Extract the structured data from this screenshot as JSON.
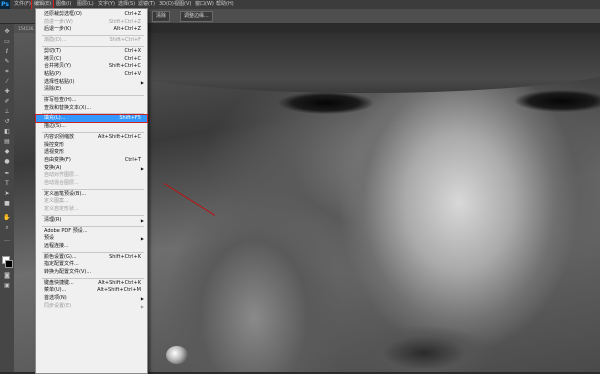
{
  "app": {
    "logo": "Ps"
  },
  "menubar": {
    "items": [
      {
        "label": "文件(F)",
        "active": false
      },
      {
        "label": "编辑(E)",
        "active": true
      },
      {
        "label": "图像(I)",
        "active": false
      },
      {
        "label": "图层(L)",
        "active": false
      },
      {
        "label": "文字(Y)",
        "active": false
      },
      {
        "label": "选择(S)",
        "active": false
      },
      {
        "label": "滤镜(T)",
        "active": false
      },
      {
        "label": "3D(D)",
        "active": false
      },
      {
        "label": "视图(V)",
        "active": false
      },
      {
        "label": "窗口(W)",
        "active": false
      },
      {
        "label": "帮助(H)",
        "active": false
      }
    ]
  },
  "optbar": {
    "buttons": [
      "清除",
      "调整边缘..."
    ]
  },
  "doc_tab": {
    "label": "154136..."
  },
  "edit_menu": {
    "items": [
      {
        "label": "还原裁剪选框(O)",
        "shortcut": "Ctrl+Z",
        "disabled": false
      },
      {
        "label": "前进一步(W)",
        "shortcut": "Shift+Ctrl+Z",
        "disabled": true
      },
      {
        "label": "后退一步(K)",
        "shortcut": "Alt+Ctrl+Z",
        "disabled": false
      },
      {
        "sep": true
      },
      {
        "label": "渐隐(D)...",
        "shortcut": "Shift+Ctrl+F",
        "disabled": true
      },
      {
        "sep": true
      },
      {
        "label": "剪切(T)",
        "shortcut": "Ctrl+X",
        "disabled": false
      },
      {
        "label": "拷贝(C)",
        "shortcut": "Ctrl+C",
        "disabled": false
      },
      {
        "label": "合并拷贝(Y)",
        "shortcut": "Shift+Ctrl+C",
        "disabled": false
      },
      {
        "label": "粘贴(P)",
        "shortcut": "Ctrl+V",
        "disabled": false
      },
      {
        "label": "选择性粘贴(I)",
        "shortcut": "",
        "disabled": false,
        "submenu": true
      },
      {
        "label": "清除(E)",
        "shortcut": "",
        "disabled": false
      },
      {
        "sep": true
      },
      {
        "label": "拼写检查(H)...",
        "shortcut": "",
        "disabled": false
      },
      {
        "label": "查找和替换文本(X)...",
        "shortcut": "",
        "disabled": false
      },
      {
        "sep": true
      },
      {
        "label": "填充(L)...",
        "shortcut": "Shift+F5",
        "disabled": false,
        "highlight": true
      },
      {
        "label": "描边(S)...",
        "shortcut": "",
        "disabled": false
      },
      {
        "sep": true
      },
      {
        "label": "内容识别缩放",
        "shortcut": "Alt+Shift+Ctrl+C",
        "disabled": false
      },
      {
        "label": "操控变形",
        "shortcut": "",
        "disabled": false
      },
      {
        "label": "透视变形",
        "shortcut": "",
        "disabled": false
      },
      {
        "label": "自由变换(F)",
        "shortcut": "Ctrl+T",
        "disabled": false
      },
      {
        "label": "变换(A)",
        "shortcut": "",
        "disabled": false,
        "submenu": true
      },
      {
        "label": "自动对齐图层...",
        "shortcut": "",
        "disabled": true
      },
      {
        "label": "自动混合图层...",
        "shortcut": "",
        "disabled": true
      },
      {
        "sep": true
      },
      {
        "label": "定义画笔预设(B)...",
        "shortcut": "",
        "disabled": false
      },
      {
        "label": "定义图案...",
        "shortcut": "",
        "disabled": true
      },
      {
        "label": "定义自定形状...",
        "shortcut": "",
        "disabled": true
      },
      {
        "sep": true
      },
      {
        "label": "清理(R)",
        "shortcut": "",
        "disabled": false,
        "submenu": true
      },
      {
        "sep": true
      },
      {
        "label": "Adobe PDF 预设...",
        "shortcut": "",
        "disabled": false
      },
      {
        "label": "预设",
        "shortcut": "",
        "disabled": false,
        "submenu": true
      },
      {
        "label": "远程连接...",
        "shortcut": "",
        "disabled": false
      },
      {
        "sep": true
      },
      {
        "label": "颜色设置(G)...",
        "shortcut": "Shift+Ctrl+K",
        "disabled": false
      },
      {
        "label": "指定配置文件...",
        "shortcut": "",
        "disabled": false
      },
      {
        "label": "转换为配置文件(V)...",
        "shortcut": "",
        "disabled": false
      },
      {
        "sep": true
      },
      {
        "label": "键盘快捷键...",
        "shortcut": "Alt+Shift+Ctrl+K",
        "disabled": false
      },
      {
        "label": "菜单(U)...",
        "shortcut": "Alt+Shift+Ctrl+M",
        "disabled": false
      },
      {
        "label": "首选项(N)",
        "shortcut": "",
        "disabled": false,
        "submenu": true
      },
      {
        "label": "同步设置(E)",
        "shortcut": "",
        "disabled": true,
        "submenu": true
      }
    ]
  },
  "colors": {
    "accent": "#3399ff",
    "annotation": "#d02020"
  }
}
